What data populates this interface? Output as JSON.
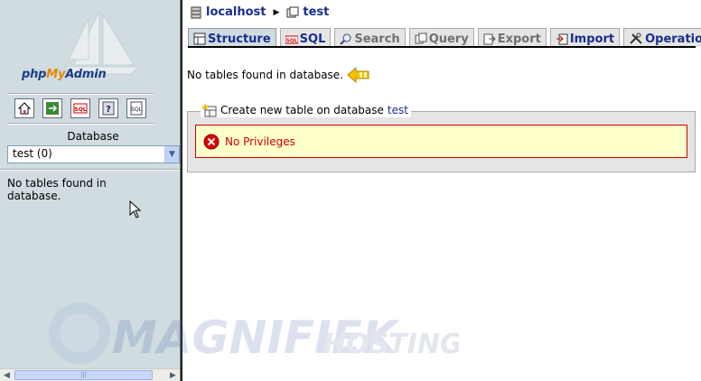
{
  "nav": {
    "logo_prefix": "php",
    "logo_my": "My",
    "logo_suffix": "Admin",
    "icons": [
      "home-icon",
      "exit-icon",
      "sql-icon",
      "help-icon",
      "docs-icon"
    ],
    "database_label": "Database",
    "selected_db": "test (0)",
    "no_tables": "No tables found in database."
  },
  "breadcrumb": {
    "server": "localhost",
    "db": "test"
  },
  "tabs": [
    {
      "label": "Structure",
      "icon": "structure-icon",
      "state": "active"
    },
    {
      "label": "SQL",
      "icon": "sql-icon",
      "state": "normal"
    },
    {
      "label": "Search",
      "icon": "search-icon",
      "state": "disabled"
    },
    {
      "label": "Query",
      "icon": "query-icon",
      "state": "disabled"
    },
    {
      "label": "Export",
      "icon": "export-icon",
      "state": "disabled"
    },
    {
      "label": "Import",
      "icon": "import-icon",
      "state": "normal"
    },
    {
      "label": "Operations",
      "icon": "operations-icon",
      "state": "normal"
    }
  ],
  "main": {
    "no_tables": "No tables found in database.",
    "create_table_prefix": "Create new table on database",
    "create_table_db": "test",
    "error": "No Privileges"
  },
  "watermark": {
    "brand_main": "MAGNIFIEK",
    "brand_tail": "HOSTING"
  },
  "colors": {
    "nav_bg": "#d0dce0",
    "link": "#1a2d8e",
    "error_text": "#cc0000",
    "error_bg": "#ffffcc",
    "fieldset_bg": "#e5e5e5"
  }
}
